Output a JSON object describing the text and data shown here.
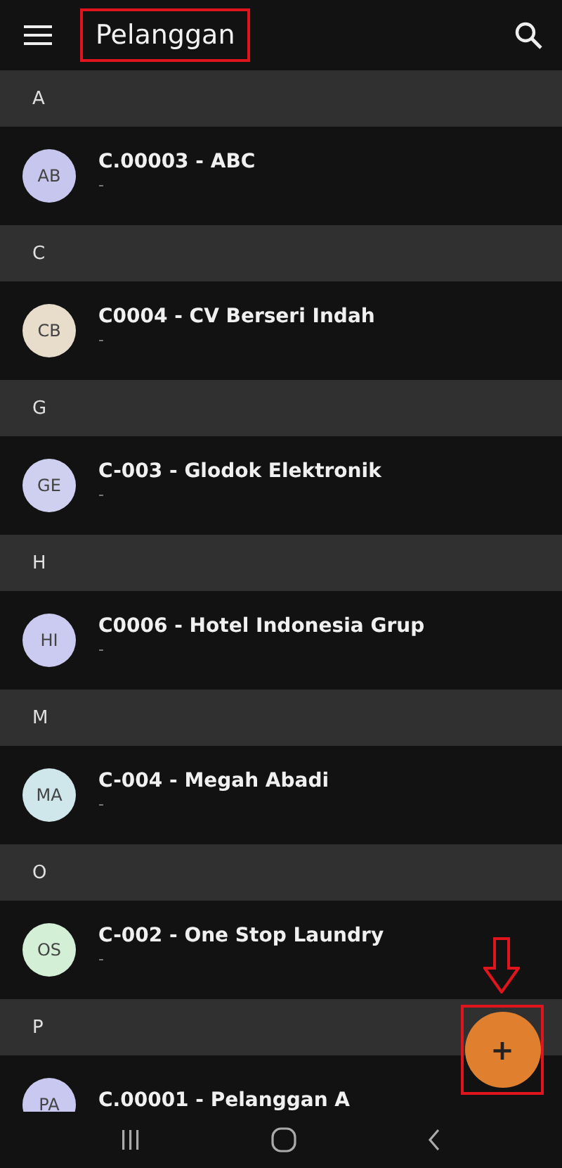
{
  "app_bar": {
    "title": "Pelanggan",
    "highlighted": true
  },
  "sections": [
    {
      "letter": "A",
      "customers": [
        {
          "initials": "AB",
          "color": "#c7c6ee",
          "name": "C.00003 - ABC",
          "subtitle": "-"
        }
      ]
    },
    {
      "letter": "C",
      "customers": [
        {
          "initials": "CB",
          "color": "#e8dccb",
          "name": "C0004 - CV Berseri Indah",
          "subtitle": "-"
        }
      ]
    },
    {
      "letter": "G",
      "customers": [
        {
          "initials": "GE",
          "color": "#cfd0f0",
          "name": "C-003 - Glodok Elektronik",
          "subtitle": "-"
        }
      ]
    },
    {
      "letter": "H",
      "customers": [
        {
          "initials": "HI",
          "color": "#cbcaf0",
          "name": "C0006 - Hotel Indonesia Grup",
          "subtitle": "-"
        }
      ]
    },
    {
      "letter": "M",
      "customers": [
        {
          "initials": "MA",
          "color": "#cfe6ea",
          "name": "C-004 - Megah Abadi",
          "subtitle": "-"
        }
      ]
    },
    {
      "letter": "O",
      "customers": [
        {
          "initials": "OS",
          "color": "#d3efd6",
          "name": "C-002 - One Stop Laundry",
          "subtitle": "-"
        }
      ]
    },
    {
      "letter": "P",
      "customers": [
        {
          "initials": "PA",
          "color": "#c9c8f0",
          "name": "C.00001 - Pelanggan A"
        }
      ]
    }
  ],
  "fab": {
    "label": "+",
    "highlighted": true,
    "pointed_at": true
  }
}
